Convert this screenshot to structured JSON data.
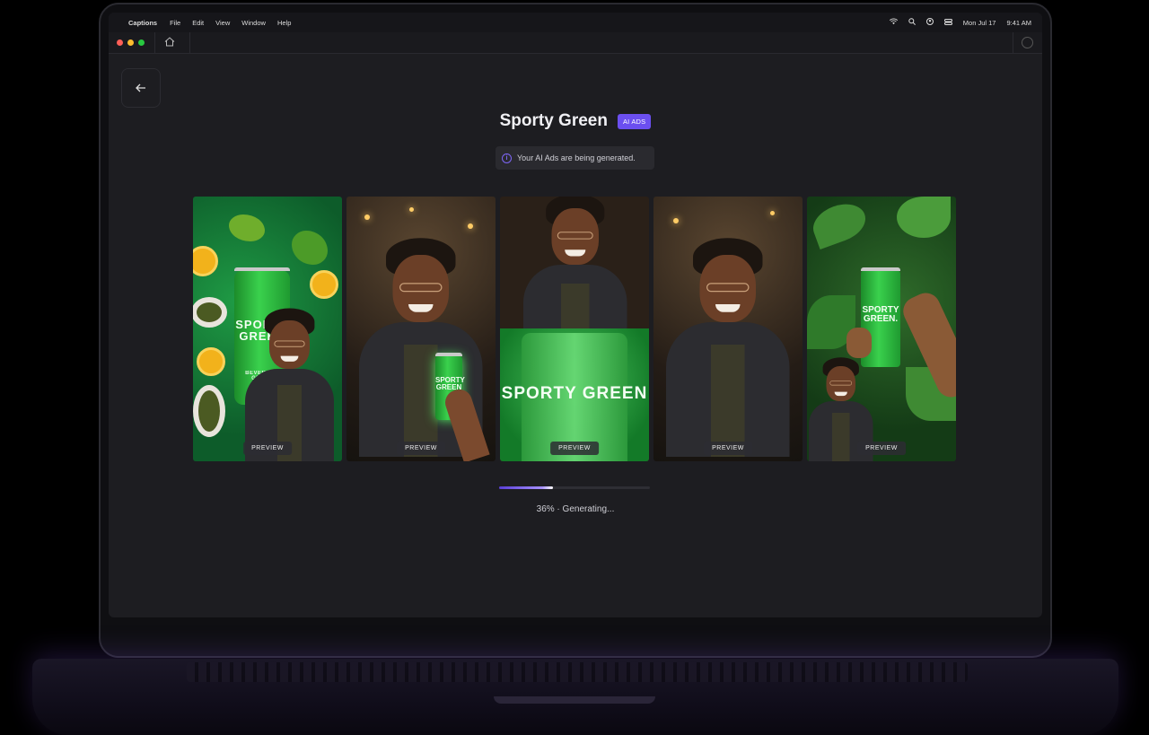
{
  "menubar": {
    "app": "Captions",
    "items": [
      "File",
      "Edit",
      "View",
      "Window",
      "Help"
    ],
    "date": "Mon Jul 17",
    "time": "9:41 AM"
  },
  "project": {
    "title": "Sporty Green",
    "badge": "AI ADS",
    "notice": "Your AI Ads are being generated."
  },
  "cards": [
    {
      "preview_label": "PREVIEW",
      "can_text": "SPORTY GREEN",
      "sub": "BEVERAGE GREEN"
    },
    {
      "preview_label": "PREVIEW",
      "can_text": "SPORTY GREEN"
    },
    {
      "preview_label": "PREVIEW",
      "can_text": "SPORTY GREEN"
    },
    {
      "preview_label": "PREVIEW"
    },
    {
      "preview_label": "PREVIEW",
      "can_text": "SPORTY GREEN."
    }
  ],
  "progress": {
    "percent": 36,
    "status": "36% · Generating..."
  },
  "colors": {
    "accent": "#6b4ff0",
    "window_bg": "#1d1d21",
    "traffic_red": "#ff5f57",
    "traffic_yellow": "#febc2e",
    "traffic_green": "#28c840"
  }
}
